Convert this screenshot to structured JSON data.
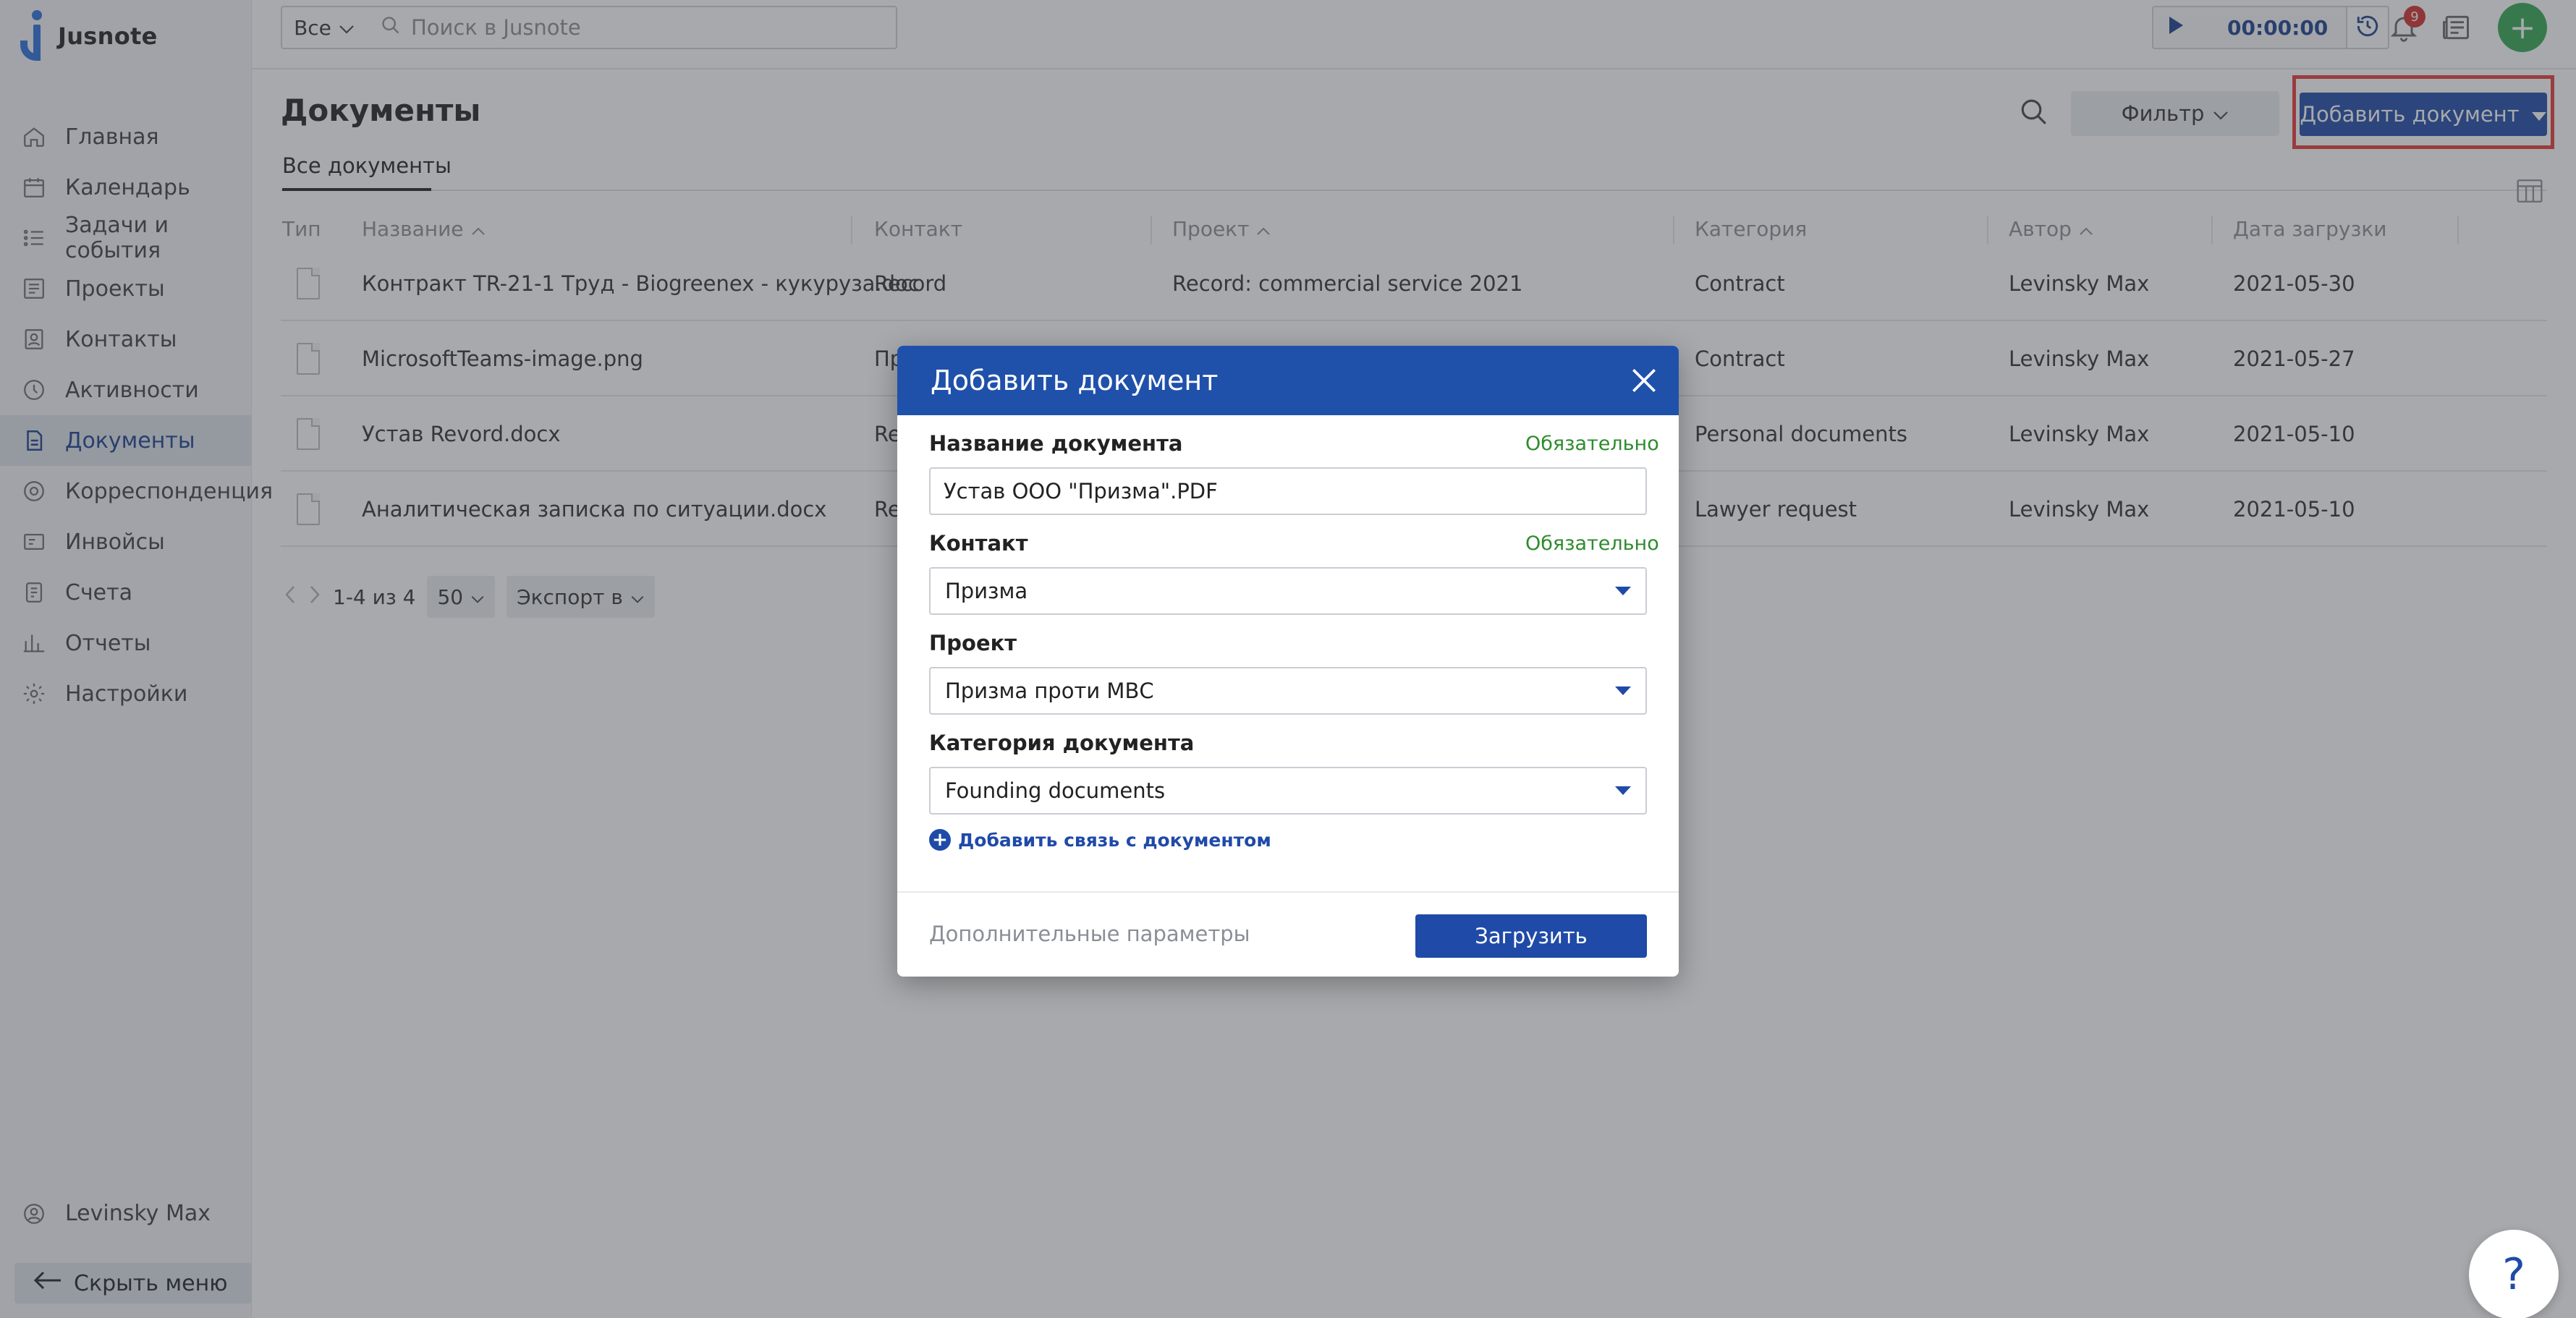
{
  "app": {
    "name": "Jusnote"
  },
  "topbar": {
    "scope_label": "Все",
    "search_placeholder": "Поиск в Jusnote",
    "timer": "00:00:00",
    "notifications_count": "9"
  },
  "sidebar": {
    "items": [
      {
        "label": "Главная",
        "icon": "home-icon"
      },
      {
        "label": "Календарь",
        "icon": "calendar-icon"
      },
      {
        "label": "Задачи и события",
        "icon": "tasks-icon"
      },
      {
        "label": "Проекты",
        "icon": "projects-icon"
      },
      {
        "label": "Контакты",
        "icon": "contacts-icon"
      },
      {
        "label": "Активности",
        "icon": "activity-icon"
      },
      {
        "label": "Документы",
        "icon": "documents-icon"
      },
      {
        "label": "Корреспонденция",
        "icon": "mail-icon"
      },
      {
        "label": "Инвойсы",
        "icon": "invoice-icon"
      },
      {
        "label": "Счета",
        "icon": "accounts-icon"
      },
      {
        "label": "Отчеты",
        "icon": "reports-icon"
      },
      {
        "label": "Настройки",
        "icon": "settings-icon"
      }
    ],
    "active_index": 6,
    "user_name": "Levinsky Max",
    "hide_menu_label": "Скрыть меню"
  },
  "main": {
    "title": "Документы",
    "filter_label": "Фильтр",
    "add_button_label": "Добавить документ",
    "tab_label": "Все документы",
    "columns": {
      "type": "Тип",
      "name": "Название",
      "contact": "Контакт",
      "project": "Проект",
      "category": "Категория",
      "author": "Автор",
      "date": "Дата загрузки"
    },
    "rows": [
      {
        "name": "Контракт TR-21-1 Труд - Biogreenex - кукуруза.doc",
        "contact": "Record",
        "project": "Record: commercial service 2021",
        "category": "Contract",
        "author": "Levinsky Max",
        "date": "2021-05-30"
      },
      {
        "name": "MicrosoftTeams-image.png",
        "contact": "Пр",
        "project": "",
        "category": "Contract",
        "author": "Levinsky Max",
        "date": "2021-05-27"
      },
      {
        "name": "Устав Revord.docx",
        "contact": "Re",
        "project": "",
        "category": "Personal documents",
        "author": "Levinsky Max",
        "date": "2021-05-10"
      },
      {
        "name": "Аналитическая записка по ситуации.docx",
        "contact": "Re",
        "project": "",
        "category": "Lawyer request",
        "author": "Levinsky Max",
        "date": "2021-05-10"
      }
    ],
    "pagination": {
      "range": "1-4 из 4",
      "page_size": "50",
      "export_label": "Экспорт в"
    }
  },
  "modal": {
    "title": "Добавить документ",
    "required_label": "Обязательно",
    "fields": {
      "name_label": "Название документа",
      "name_value": "Устав ООО \"Призма\".PDF",
      "contact_label": "Контакт",
      "contact_value": "Призма",
      "project_label": "Проект",
      "project_value": "Призма проти МВС",
      "category_label": "Категория документа",
      "category_value": "Founding documents"
    },
    "add_link_label": "Добавить связь с документом",
    "extra_params_label": "Дополнительные параметры",
    "upload_label": "Загрузить"
  },
  "colors": {
    "primary": "#1f4aa8",
    "modal_header": "#2051aa",
    "required_green": "#2e8b2e",
    "add_green": "#34a853",
    "highlight_red": "#e53935",
    "badge_red": "#d32f2f"
  }
}
